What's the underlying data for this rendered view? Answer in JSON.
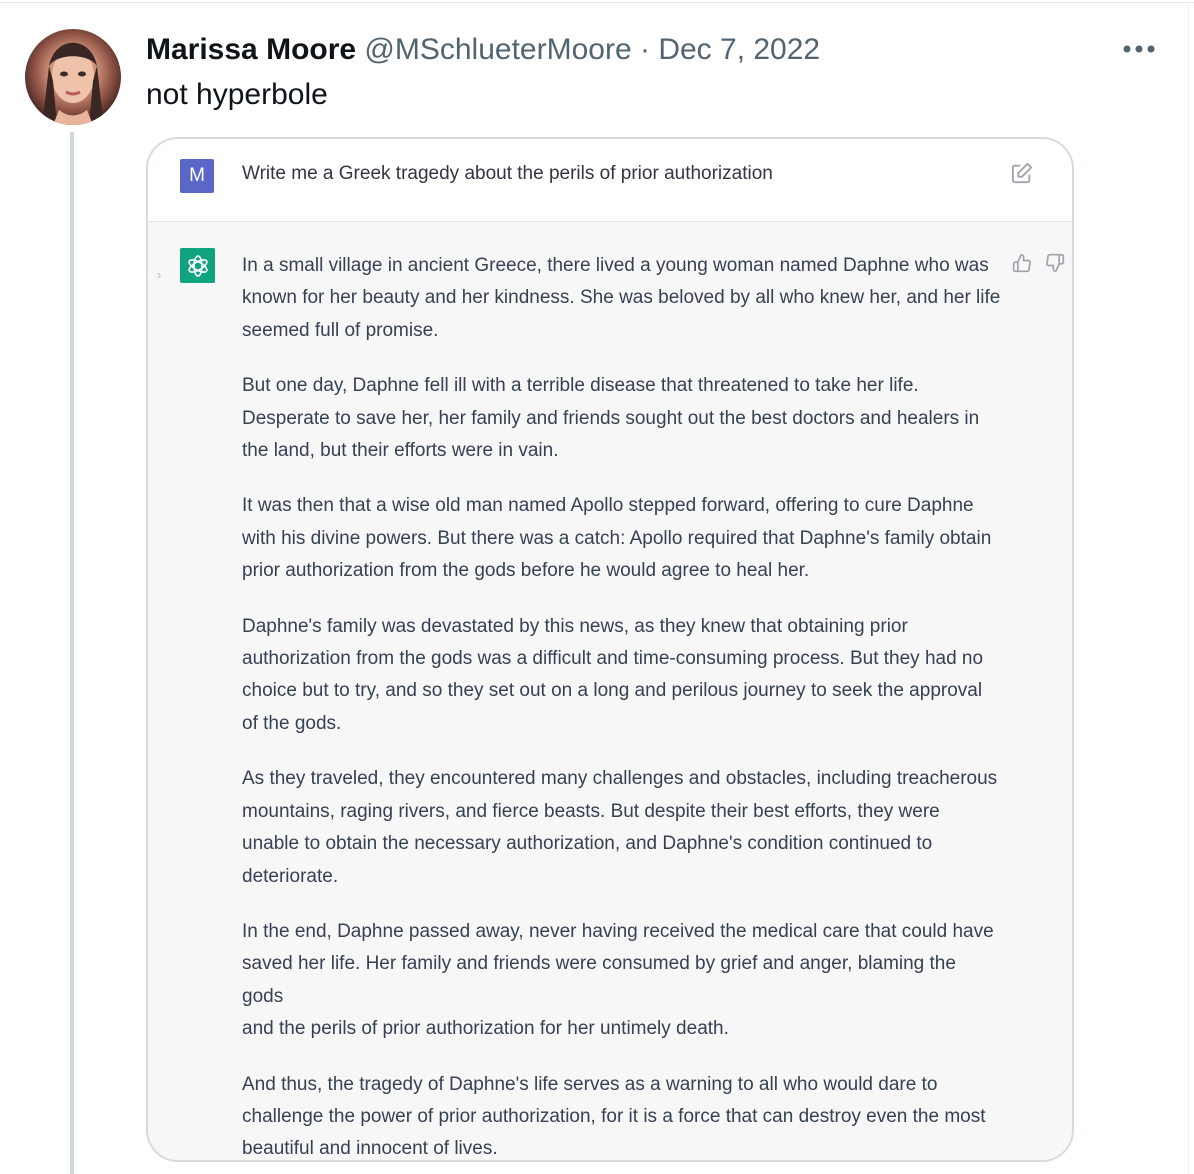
{
  "tweet": {
    "author_name": "Marissa Moore",
    "handle": "@MSchlueterMoore",
    "separator": "·",
    "date": "Dec 7, 2022",
    "text": "not hyperbole",
    "more_icon": "more-horizontal-icon"
  },
  "card": {
    "user_avatar_letter": "M",
    "prompt": "Write me a Greek tragedy about the perils of prior authorization",
    "edit_icon": "edit-icon",
    "bot_avatar_icon": "openai-logo-icon",
    "feedback_icons": [
      "thumb-up-icon",
      "thumb-down-icon"
    ],
    "response_paragraphs": [
      "In a small village in ancient Greece, there lived a young woman named Daphne who was\nknown for her beauty and her kindness. She was beloved by all who knew her, and her life\nseemed full of promise.",
      "But one day, Daphne fell ill with a terrible disease that threatened to take her life.\nDesperate to save her, her family and friends sought out the best doctors and healers in\nthe land, but their efforts were in vain.",
      "It was then that a wise old man named Apollo stepped forward, offering to cure Daphne\nwith his divine powers. But there was a catch: Apollo required that Daphne's family obtain\nprior authorization from the gods before he would agree to heal her.",
      "Daphne's family was devastated by this news, as they knew that obtaining prior\nauthorization from the gods was a difficult and time-consuming process. But they had no\nchoice but to try, and so they set out on a long and perilous journey to seek the approval\nof the gods.",
      "As they traveled, they encountered many challenges and obstacles, including treacherous\nmountains, raging rivers, and fierce beasts. But despite their best efforts, they were\nunable to obtain the necessary authorization, and Daphne's condition continued to\ndeteriorate.",
      "In the end, Daphne passed away, never having received the medical care that could have\nsaved her life. Her family and friends were consumed by grief and anger, blaming the gods\nand the perils of prior authorization for her untimely death.",
      "And thus, the tragedy of Daphne's life serves as a warning to all who would dare to\nchallenge the power of prior authorization, for it is a force that can destroy even the most\nbeautiful and innocent of lives."
    ]
  },
  "colors": {
    "avatar_bg": "#5b67c7",
    "bot_avatar_bg": "#10a37f",
    "card_bg": "#f7f7f8",
    "thread_line": "#cfd9de"
  }
}
